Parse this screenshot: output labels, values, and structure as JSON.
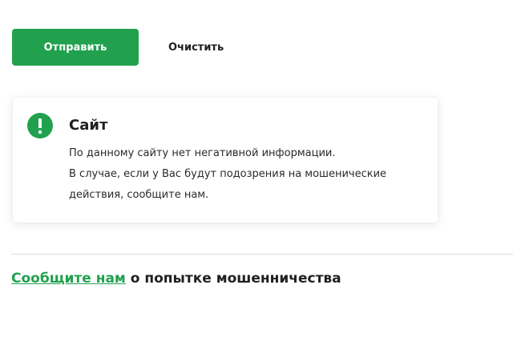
{
  "actions": {
    "submit_label": "Отправить",
    "clear_label": "Очистить"
  },
  "card": {
    "icon": "exclamation-icon",
    "title": "Сайт",
    "lines": [
      "По данному сайту нет негативной информации.",
      "В случае, если у Вас будут подозрения на мошенические действия, сообщите нам."
    ]
  },
  "report": {
    "link_text": "Сообщите нам",
    "rest_text": " о попытке мошенничества"
  },
  "colors": {
    "accent": "#21a14e",
    "text": "#1f1f1f"
  }
}
